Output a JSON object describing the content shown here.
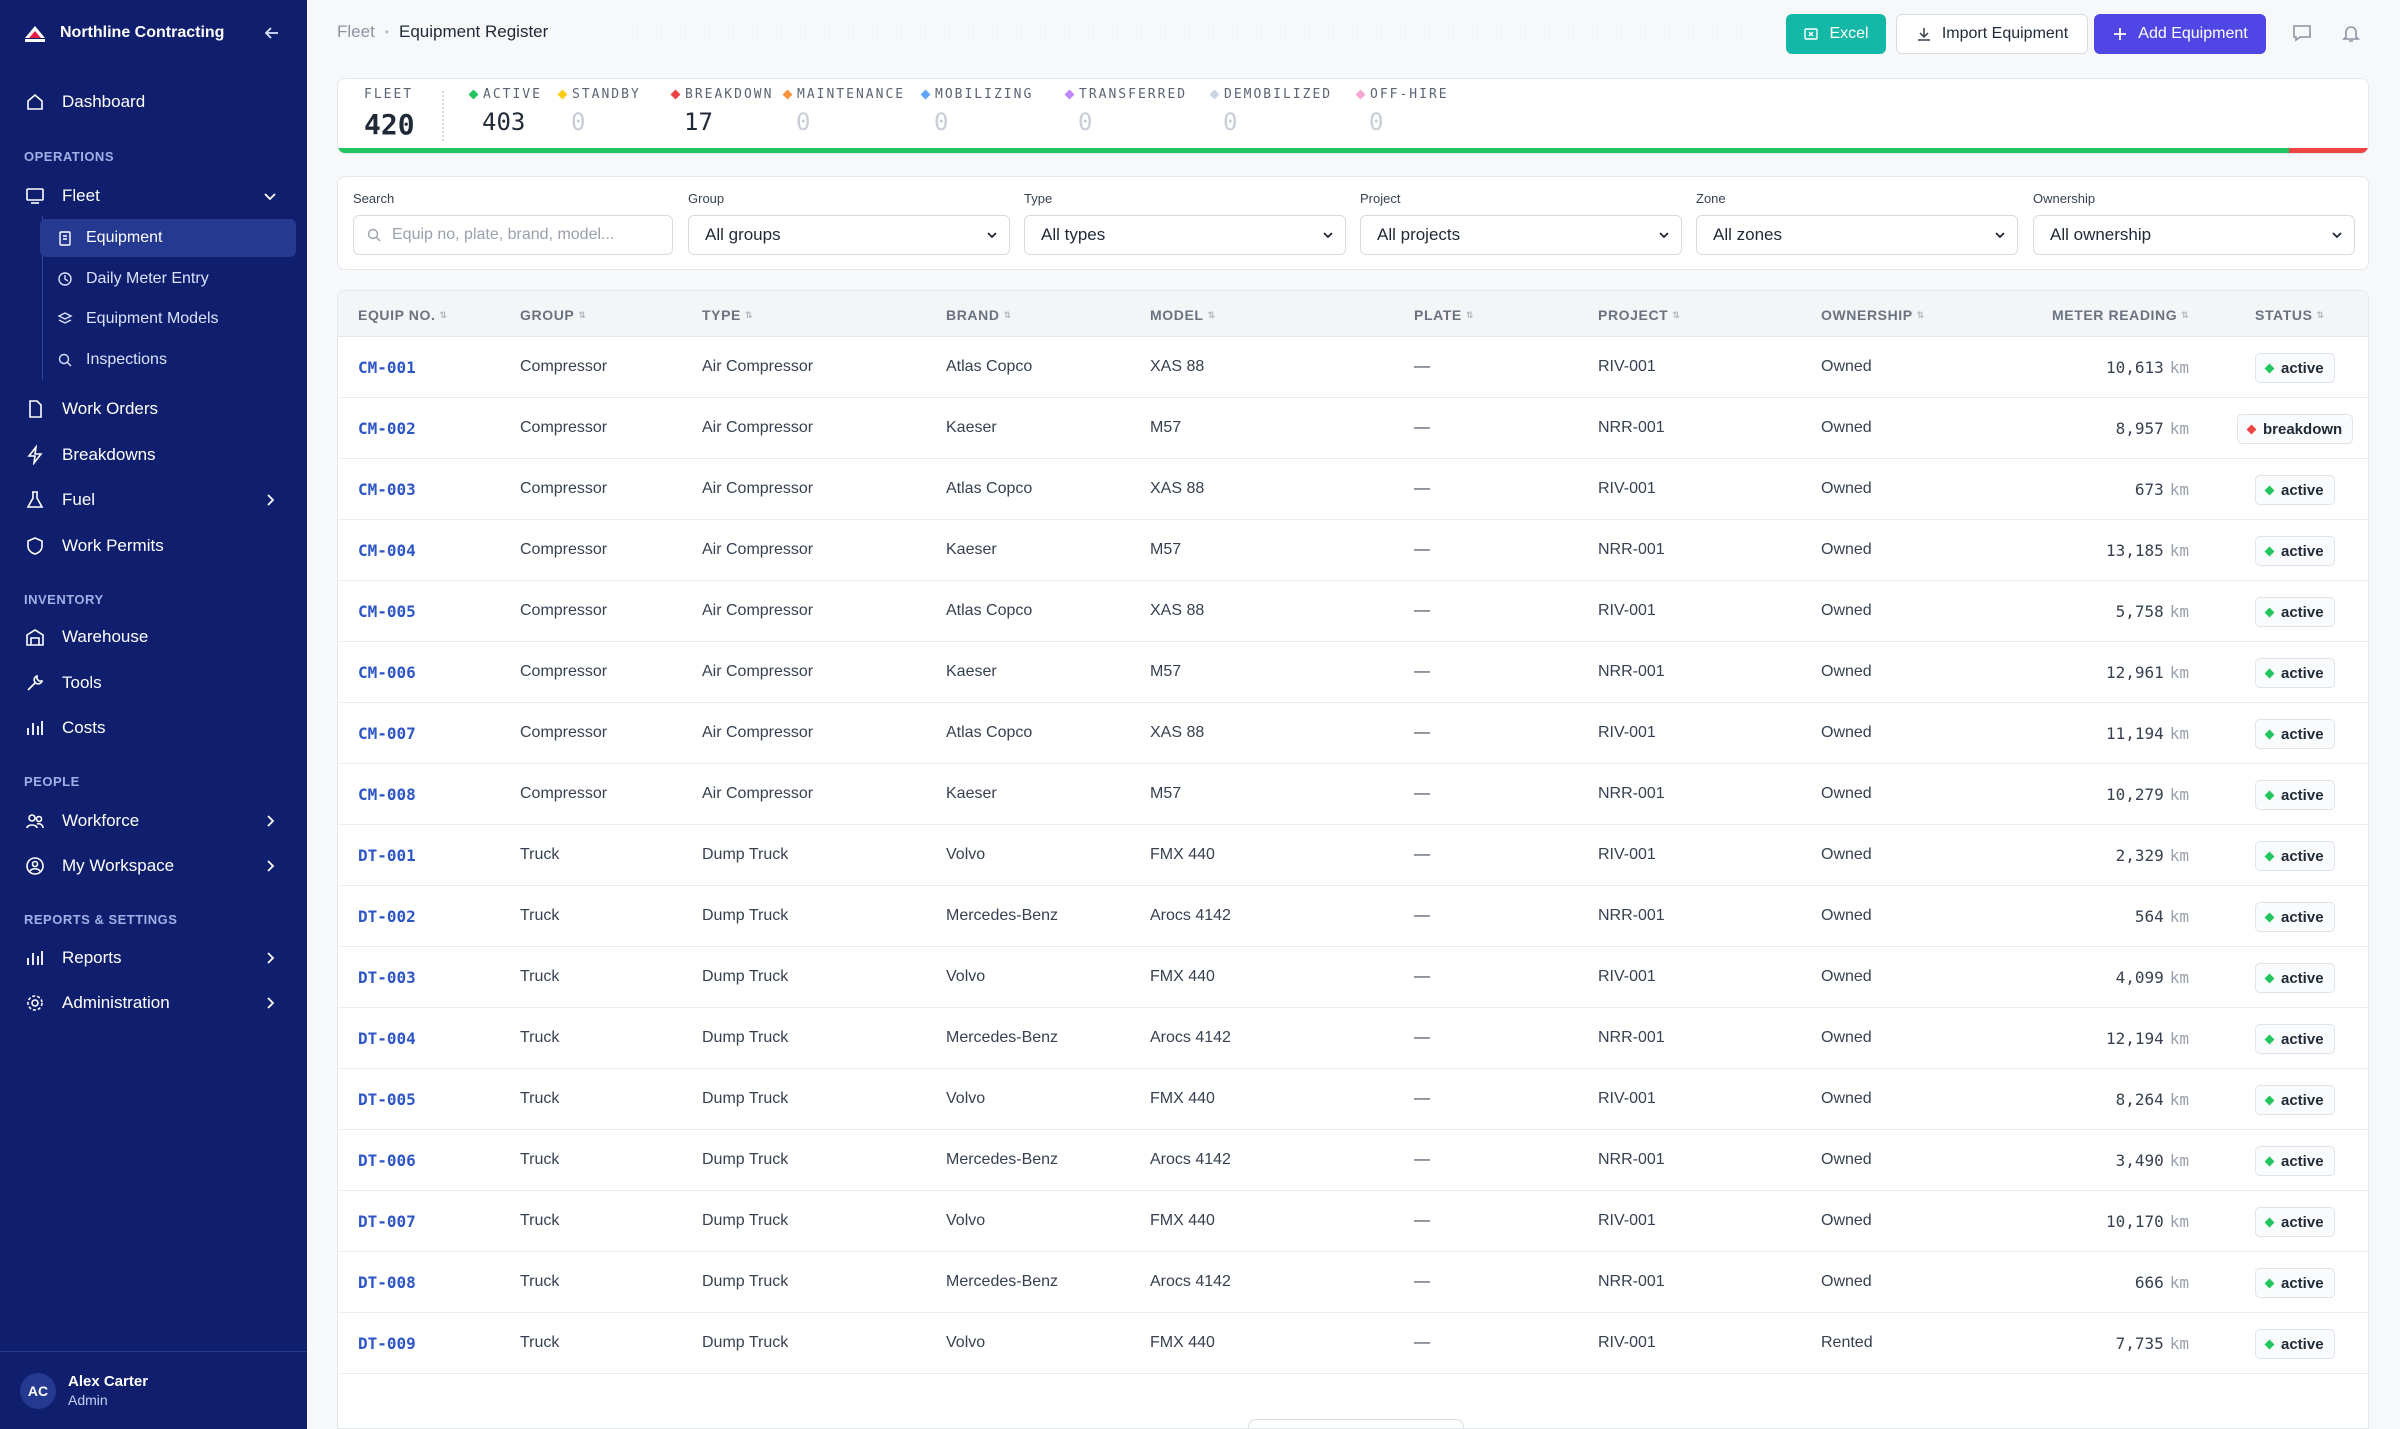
{
  "app": {
    "company": "Northline Contracting"
  },
  "nav": {
    "dashboard": "Dashboard",
    "sections": {
      "operations": "OPERATIONS",
      "inventory": "INVENTORY",
      "people": "PEOPLE",
      "reports": "REPORTS & SETTINGS"
    },
    "fleet": "Fleet",
    "fleet_sub": {
      "equipment": "Equipment",
      "meter": "Daily Meter Entry",
      "models": "Equipment Models",
      "inspections": "Inspections"
    },
    "work_orders": "Work Orders",
    "breakdowns": "Breakdowns",
    "fuel": "Fuel",
    "work_permits": "Work Permits",
    "warehouse": "Warehouse",
    "tools": "Tools",
    "costs": "Costs",
    "workforce": "Workforce",
    "my_workspace": "My Workspace",
    "reports_item": "Reports",
    "administration": "Administration"
  },
  "user": {
    "initials": "AC",
    "name": "Alex Carter",
    "role": "Admin"
  },
  "header": {
    "breadcrumb_parent": "Fleet",
    "breadcrumb_current": "Equipment Register",
    "excel_label": "Excel",
    "import_label": "Import Equipment",
    "add_label": "Add Equipment"
  },
  "stats": {
    "fleet": {
      "label": "FLEET",
      "value": "420"
    },
    "items": [
      {
        "label": "ACTIVE",
        "value": "403",
        "color": "#22c55e"
      },
      {
        "label": "STANDBY",
        "value": "0",
        "color": "#facc15"
      },
      {
        "label": "BREAKDOWN",
        "value": "17",
        "color": "#ef4444"
      },
      {
        "label": "MAINTENANCE",
        "value": "0",
        "color": "#fb923c"
      },
      {
        "label": "MOBILIZING",
        "value": "0",
        "color": "#60a5fa"
      },
      {
        "label": "TRANSFERRED",
        "value": "0",
        "color": "#c084fc"
      },
      {
        "label": "DEMOBILIZED",
        "value": "0",
        "color": "#cbd5e1"
      },
      {
        "label": "OFF-HIRE",
        "value": "0",
        "color": "#f9a8d4"
      }
    ],
    "active_fraction": 0.96,
    "breakdown_fraction": 0.04
  },
  "filters": {
    "search_label": "Search",
    "search_placeholder": "Equip no, plate, brand, model...",
    "group_label": "Group",
    "group_value": "All groups",
    "type_label": "Type",
    "type_value": "All types",
    "project_label": "Project",
    "project_value": "All projects",
    "zone_label": "Zone",
    "zone_value": "All zones",
    "ownership_label": "Ownership",
    "ownership_value": "All ownership"
  },
  "table": {
    "columns": [
      "EQUIP NO.",
      "GROUP",
      "TYPE",
      "BRAND",
      "MODEL",
      "PLATE",
      "PROJECT",
      "OWNERSHIP",
      "METER READING",
      "STATUS"
    ],
    "unit": "km",
    "rows": [
      {
        "equip": "CM-001",
        "group": "Compressor",
        "type": "Air Compressor",
        "brand": "Atlas Copco",
        "model": "XAS 88",
        "plate": "—",
        "project": "RIV-001",
        "ownership": "Owned",
        "meter": "10,613",
        "status": "active"
      },
      {
        "equip": "CM-002",
        "group": "Compressor",
        "type": "Air Compressor",
        "brand": "Kaeser",
        "model": "M57",
        "plate": "—",
        "project": "NRR-001",
        "ownership": "Owned",
        "meter": "8,957",
        "status": "breakdown"
      },
      {
        "equip": "CM-003",
        "group": "Compressor",
        "type": "Air Compressor",
        "brand": "Atlas Copco",
        "model": "XAS 88",
        "plate": "—",
        "project": "RIV-001",
        "ownership": "Owned",
        "meter": "673",
        "status": "active"
      },
      {
        "equip": "CM-004",
        "group": "Compressor",
        "type": "Air Compressor",
        "brand": "Kaeser",
        "model": "M57",
        "plate": "—",
        "project": "NRR-001",
        "ownership": "Owned",
        "meter": "13,185",
        "status": "active"
      },
      {
        "equip": "CM-005",
        "group": "Compressor",
        "type": "Air Compressor",
        "brand": "Atlas Copco",
        "model": "XAS 88",
        "plate": "—",
        "project": "RIV-001",
        "ownership": "Owned",
        "meter": "5,758",
        "status": "active"
      },
      {
        "equip": "CM-006",
        "group": "Compressor",
        "type": "Air Compressor",
        "brand": "Kaeser",
        "model": "M57",
        "plate": "—",
        "project": "NRR-001",
        "ownership": "Owned",
        "meter": "12,961",
        "status": "active"
      },
      {
        "equip": "CM-007",
        "group": "Compressor",
        "type": "Air Compressor",
        "brand": "Atlas Copco",
        "model": "XAS 88",
        "plate": "—",
        "project": "RIV-001",
        "ownership": "Owned",
        "meter": "11,194",
        "status": "active"
      },
      {
        "equip": "CM-008",
        "group": "Compressor",
        "type": "Air Compressor",
        "brand": "Kaeser",
        "model": "M57",
        "plate": "—",
        "project": "NRR-001",
        "ownership": "Owned",
        "meter": "10,279",
        "status": "active"
      },
      {
        "equip": "DT-001",
        "group": "Truck",
        "type": "Dump Truck",
        "brand": "Volvo",
        "model": "FMX 440",
        "plate": "—",
        "project": "RIV-001",
        "ownership": "Owned",
        "meter": "2,329",
        "status": "active"
      },
      {
        "equip": "DT-002",
        "group": "Truck",
        "type": "Dump Truck",
        "brand": "Mercedes-Benz",
        "model": "Arocs 4142",
        "plate": "—",
        "project": "NRR-001",
        "ownership": "Owned",
        "meter": "564",
        "status": "active"
      },
      {
        "equip": "DT-003",
        "group": "Truck",
        "type": "Dump Truck",
        "brand": "Volvo",
        "model": "FMX 440",
        "plate": "—",
        "project": "RIV-001",
        "ownership": "Owned",
        "meter": "4,099",
        "status": "active"
      },
      {
        "equip": "DT-004",
        "group": "Truck",
        "type": "Dump Truck",
        "brand": "Mercedes-Benz",
        "model": "Arocs 4142",
        "plate": "—",
        "project": "NRR-001",
        "ownership": "Owned",
        "meter": "12,194",
        "status": "active"
      },
      {
        "equip": "DT-005",
        "group": "Truck",
        "type": "Dump Truck",
        "brand": "Volvo",
        "model": "FMX 440",
        "plate": "—",
        "project": "RIV-001",
        "ownership": "Owned",
        "meter": "8,264",
        "status": "active"
      },
      {
        "equip": "DT-006",
        "group": "Truck",
        "type": "Dump Truck",
        "brand": "Mercedes-Benz",
        "model": "Arocs 4142",
        "plate": "—",
        "project": "NRR-001",
        "ownership": "Owned",
        "meter": "3,490",
        "status": "active"
      },
      {
        "equip": "DT-007",
        "group": "Truck",
        "type": "Dump Truck",
        "brand": "Volvo",
        "model": "FMX 440",
        "plate": "—",
        "project": "RIV-001",
        "ownership": "Owned",
        "meter": "10,170",
        "status": "active"
      },
      {
        "equip": "DT-008",
        "group": "Truck",
        "type": "Dump Truck",
        "brand": "Mercedes-Benz",
        "model": "Arocs 4142",
        "plate": "—",
        "project": "NRR-001",
        "ownership": "Owned",
        "meter": "666",
        "status": "active"
      },
      {
        "equip": "DT-009",
        "group": "Truck",
        "type": "Dump Truck",
        "brand": "Volvo",
        "model": "FMX 440",
        "plate": "—",
        "project": "RIV-001",
        "ownership": "Rented",
        "meter": "7,735",
        "status": "active"
      }
    ]
  },
  "status_colors": {
    "active": "#22c55e",
    "breakdown": "#ef4444"
  }
}
